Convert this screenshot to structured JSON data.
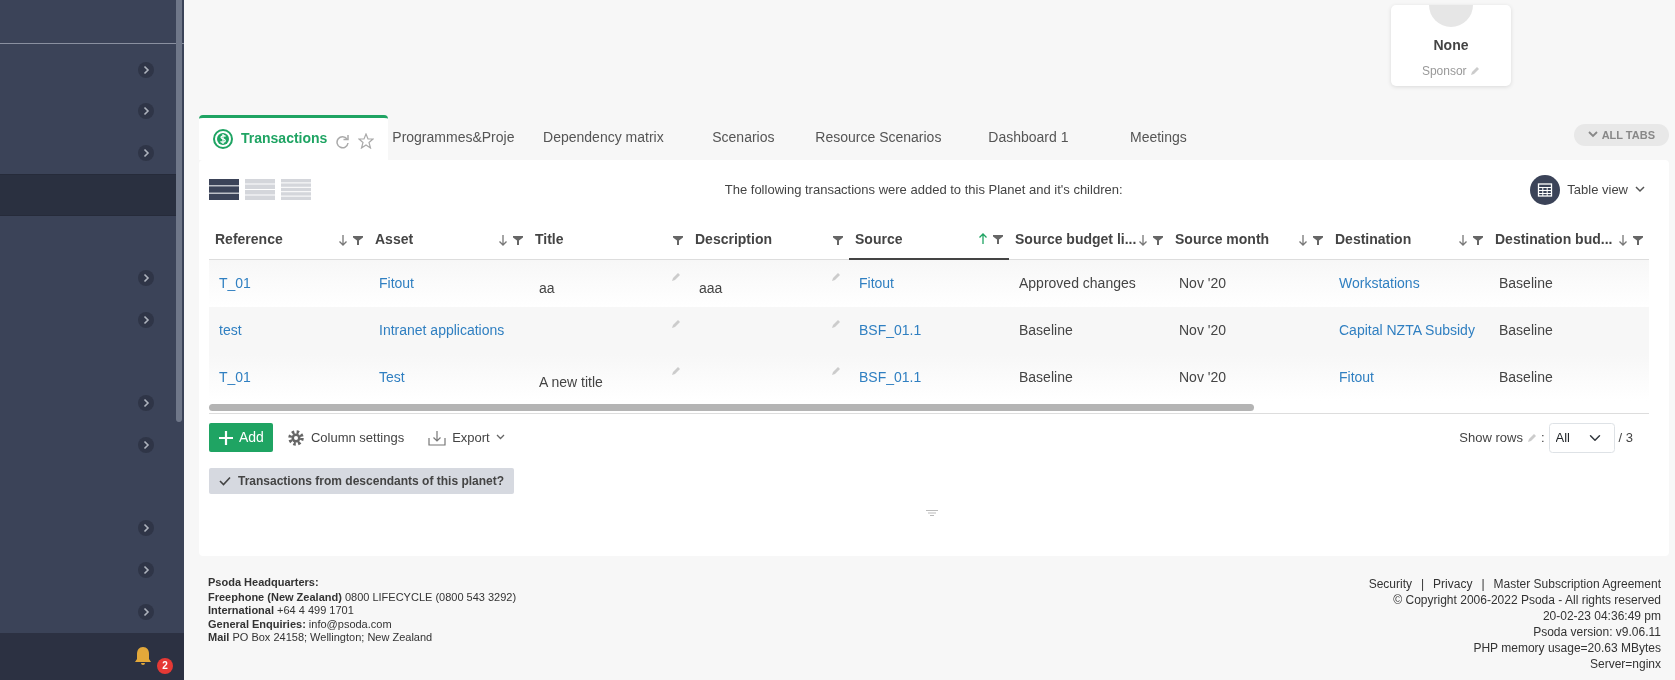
{
  "sidebar": {
    "items": [
      {
        "has_children": true,
        "selected": false
      },
      {
        "has_children": true,
        "selected": false
      },
      {
        "has_children": true,
        "selected": false
      },
      {
        "has_children": false,
        "selected": true
      },
      {
        "has_children": false,
        "selected": false
      },
      {
        "has_children": true,
        "selected": false
      },
      {
        "has_children": true,
        "selected": false
      },
      {
        "has_children": false,
        "selected": false
      },
      {
        "has_children": true,
        "selected": false
      },
      {
        "has_children": true,
        "selected": false
      },
      {
        "has_children": false,
        "selected": false
      },
      {
        "has_children": true,
        "selected": false
      },
      {
        "has_children": true,
        "selected": false
      },
      {
        "has_children": true,
        "selected": false
      }
    ],
    "notifications": {
      "count": "2"
    }
  },
  "sponsor_card": {
    "name": "None",
    "role": "Sponsor"
  },
  "tabs": [
    {
      "label": "Transactions",
      "selected": true
    },
    {
      "label": "Programmes&Proje",
      "selected": false
    },
    {
      "label": "Dependency matrix",
      "selected": false
    },
    {
      "label": "Scenarios",
      "selected": false
    },
    {
      "label": "Resource Scenarios",
      "selected": false
    },
    {
      "label": "Dashboard 1",
      "selected": false
    },
    {
      "label": "Meetings",
      "selected": false
    }
  ],
  "all_tabs_button": "ALL TABS",
  "density_options": [
    {
      "selected": true
    },
    {
      "selected": false
    },
    {
      "selected": false
    }
  ],
  "message": "The following transactions were added to this Planet and it's children:",
  "view_selector": "Table view",
  "table": {
    "columns": [
      {
        "label": "Reference",
        "sortable": true,
        "sorted_ascending": false,
        "editable": false
      },
      {
        "label": "Asset",
        "sortable": true,
        "sorted_ascending": false,
        "editable": false
      },
      {
        "label": "Title",
        "sortable": false,
        "sorted_ascending": false,
        "editable": true
      },
      {
        "label": "Description",
        "sortable": false,
        "sorted_ascending": false,
        "editable": true
      },
      {
        "label": "Source",
        "sortable": true,
        "sorted_ascending": true,
        "editable": false
      },
      {
        "label": "Source budget li...",
        "sortable": true,
        "sorted_ascending": false,
        "editable": false
      },
      {
        "label": "Source month",
        "sortable": true,
        "sorted_ascending": false,
        "editable": false
      },
      {
        "label": "Destination",
        "sortable": true,
        "sorted_ascending": false,
        "editable": false
      },
      {
        "label": "Destination bud...",
        "sortable": true,
        "sorted_ascending": false,
        "editable": false
      }
    ],
    "rows": [
      [
        {
          "text": "T_01",
          "link": true
        },
        {
          "text": "Fitout",
          "link": true
        },
        {
          "text": "aa",
          "link": false
        },
        {
          "text": "aaa",
          "link": false
        },
        {
          "text": "Fitout",
          "link": true
        },
        {
          "text": "Approved changes",
          "link": false
        },
        {
          "text": "Nov '20",
          "link": false
        },
        {
          "text": "Workstations",
          "link": true
        },
        {
          "text": "Baseline",
          "link": false
        }
      ],
      [
        {
          "text": "test",
          "link": true
        },
        {
          "text": "Intranet applications",
          "link": true
        },
        null,
        null,
        {
          "text": "BSF_01.1",
          "link": true
        },
        {
          "text": "Baseline",
          "link": false
        },
        {
          "text": "Nov '20",
          "link": false
        },
        {
          "text": "Capital NZTA Subsidy",
          "link": true
        },
        {
          "text": "Baseline",
          "link": false
        }
      ],
      [
        {
          "text": "T_01",
          "link": true
        },
        {
          "text": "Test",
          "link": true
        },
        {
          "text": "A new title",
          "link": false
        },
        null,
        {
          "text": "BSF_01.1",
          "link": true
        },
        {
          "text": "Baseline",
          "link": false
        },
        {
          "text": "Nov '20",
          "link": false
        },
        {
          "text": "Fitout",
          "link": true
        },
        {
          "text": "Baseline",
          "link": false
        }
      ]
    ]
  },
  "actions": {
    "add": "Add",
    "column_settings": "Column settings",
    "export": "Export"
  },
  "show_rows": {
    "label": "Show rows",
    "separator": ":",
    "value": "All",
    "total": "/ 3"
  },
  "descendants_toggle": {
    "label": "Transactions from descendants of this planet?",
    "checked": true
  },
  "footer": {
    "left": [
      "**Psoda Headquarters:**",
      "**Freephone (New Zealand)** 0800 LIFECYCLE (0800 543 3292)",
      "**International** +64 4 499 1701",
      "**General Enquiries:** info@psoda.com",
      "**Mail** PO Box 24158; Wellington; New Zealand"
    ],
    "links": [
      "Security",
      "Privacy",
      "Master Subscription Agreement"
    ],
    "link_separator": "|",
    "right": [
      "© Copyright 2006-2022 Psoda - All rights reserved",
      "20-02-23 04:36:49 pm",
      "Psoda version: v9.06.11",
      "PHP memory usage=20.63 MBytes",
      "Server=nginx"
    ]
  }
}
